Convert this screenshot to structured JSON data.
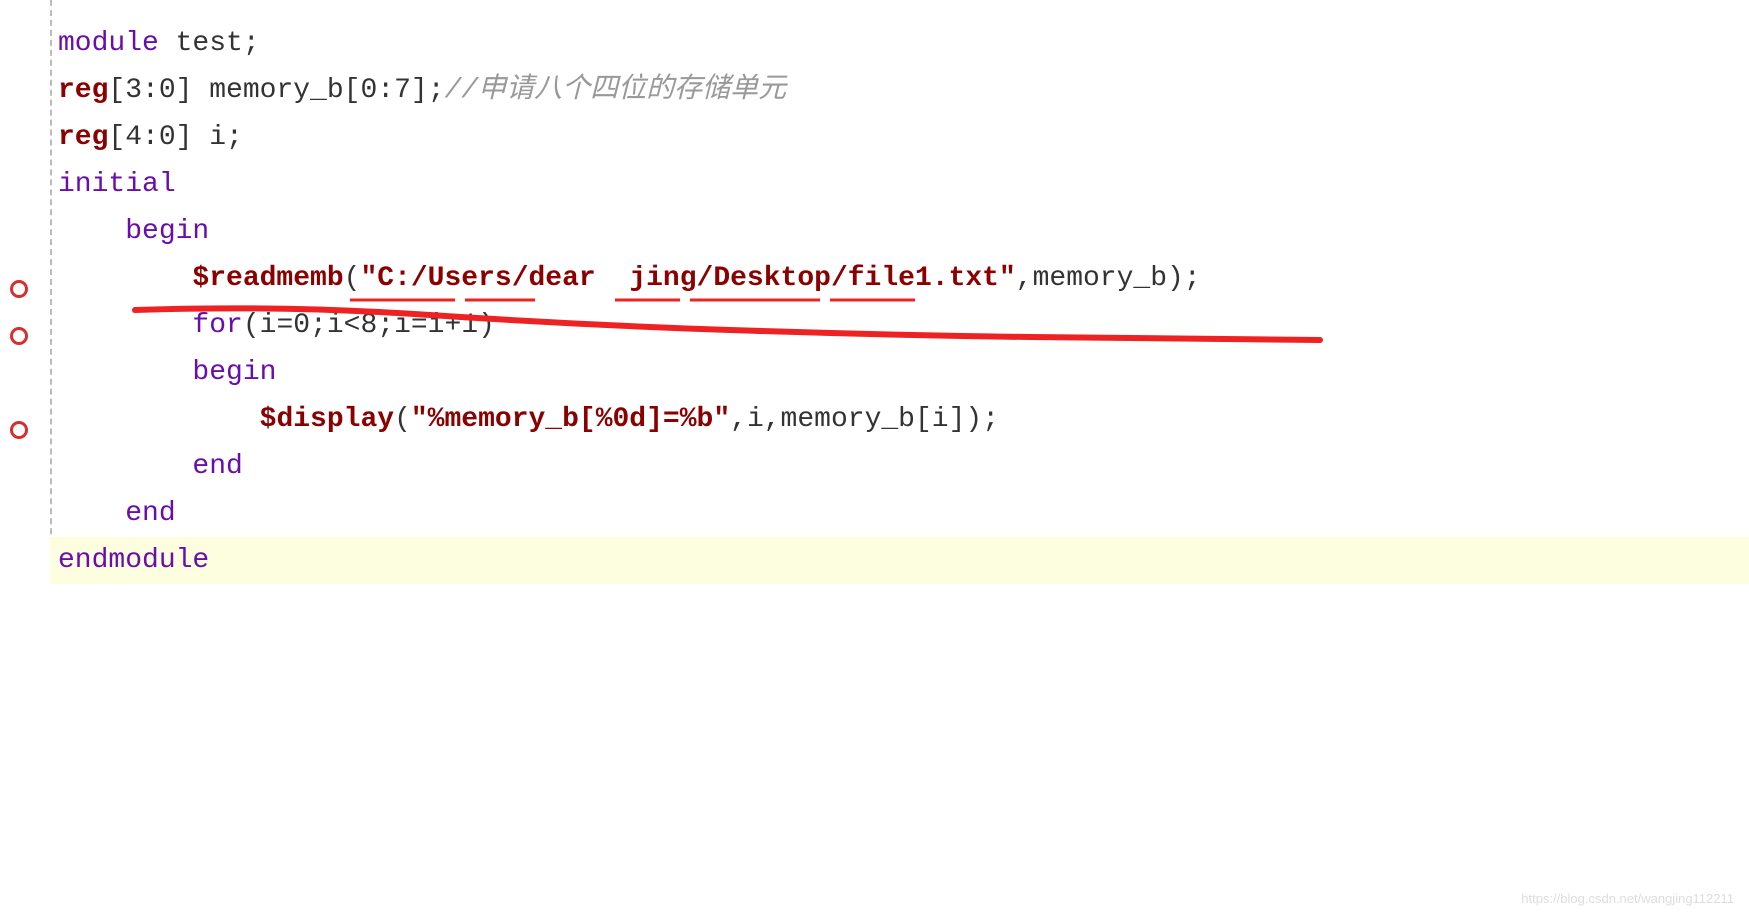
{
  "code": {
    "line1": {
      "kw_module": "module",
      "name": " test",
      "semi": ";"
    },
    "line2": {
      "kw_reg": "reg",
      "range": "[3:0]",
      "name": " memory_b",
      "idx": "[0:7]",
      "semi": ";",
      "comment": "//申请八个四位的存储单元"
    },
    "line3": {
      "kw_reg": "reg",
      "range": "[4:0]",
      "name": " i",
      "semi": ";"
    },
    "line4": {
      "kw": "initial"
    },
    "line5": {
      "indent": "    ",
      "kw": "begin"
    },
    "line6": {
      "indent": "        ",
      "task": "$readmemb",
      "paren1": "(",
      "str": "\"C:/Users/dear  jing/Desktop/file1.txt\"",
      "comma": ",",
      "arg": "memory_b",
      "paren2": ")",
      "semi": ";"
    },
    "line7": {
      "indent": "        ",
      "kw_for": "for",
      "cond": "(i=0;i<8;i=i+1)"
    },
    "line8": {
      "indent": "        ",
      "kw": "begin"
    },
    "line9": {
      "indent": "            ",
      "task": "$display",
      "paren1": "(",
      "str": "\"%memory_b[%0d]=%b\"",
      "rest": ",i,memory_b[i])",
      "semi": ";"
    },
    "line10": {
      "indent": "        ",
      "kw": "end"
    },
    "line11": {
      "indent": "    ",
      "kw": "end"
    },
    "line12": {
      "kw": "endmodule"
    }
  },
  "watermark": "https://blog.csdn.net/wangjing112211"
}
